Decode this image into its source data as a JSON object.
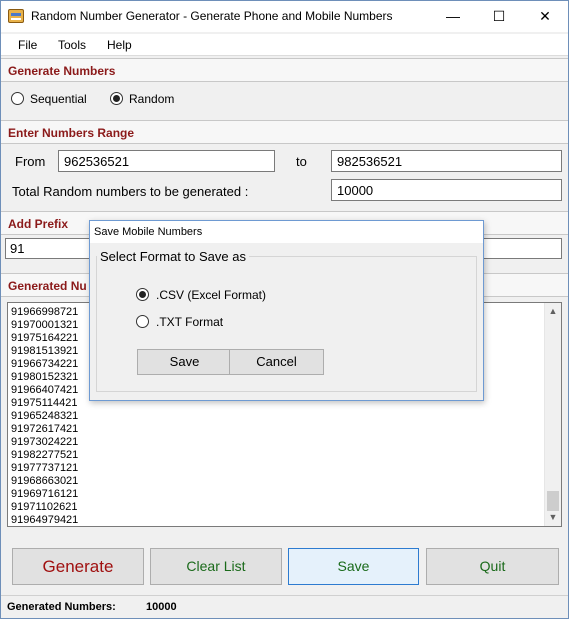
{
  "window": {
    "title": "Random Number Generator - Generate Phone and Mobile Numbers",
    "controls": {
      "minimize": "—",
      "maximize": "☐",
      "close": "✕"
    }
  },
  "menu": [
    "File",
    "Tools",
    "Help"
  ],
  "generate_section": {
    "title": "Generate Numbers",
    "options": [
      "Sequential",
      "Random"
    ],
    "selected": "Random"
  },
  "range_section": {
    "title": "Enter Numbers Range",
    "from_label": "From",
    "from_value": "962536521",
    "to_label": "to",
    "to_value": "982536521",
    "total_label": "Total Random numbers to be generated :",
    "total_value": "10000"
  },
  "prefix_section": {
    "title": "Add Prefix",
    "value": "91"
  },
  "generated_section": {
    "title": "Generated Nu",
    "numbers": [
      "91966998721",
      "91970001321",
      "91975164221",
      "91981513921",
      "91966734221",
      "91980152321",
      "91966407421",
      "91975114421",
      "91965248321",
      "91972617421",
      "91973024221",
      "91982277521",
      "91977737121",
      "91968663021",
      "91969716121",
      "91971102621",
      "91964979421"
    ]
  },
  "buttons": {
    "generate": "Generate",
    "clear": "Clear List",
    "save": "Save",
    "quit": "Quit"
  },
  "status": {
    "label": "Generated Numbers:",
    "value": "10000"
  },
  "dialog": {
    "title": "Save Mobile Numbers",
    "group_label": "Select Format to Save as",
    "options": [
      ".CSV (Excel Format)",
      ".TXT Format"
    ],
    "selected": ".CSV (Excel Format)",
    "save_button": "Save",
    "cancel_button": "Cancel"
  }
}
